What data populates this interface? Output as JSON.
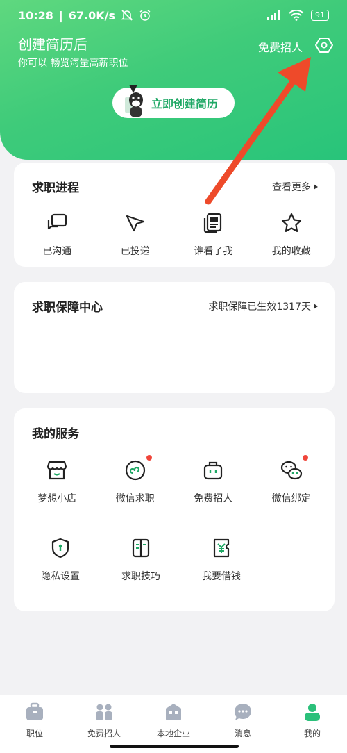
{
  "status_bar": {
    "time": "10:28",
    "speed": "67.0K/s",
    "battery": "91"
  },
  "hero": {
    "title": "创建简历后",
    "subtitle": "你可以 畅览海量高薪职位",
    "free_recruit": "免费招人",
    "create_button": "立即创建简历"
  },
  "job_progress": {
    "title": "求职进程",
    "more": "查看更多",
    "items": [
      {
        "label": "已沟通",
        "icon": "chat-icon"
      },
      {
        "label": "已投递",
        "icon": "send-icon"
      },
      {
        "label": "谁看了我",
        "icon": "document-icon"
      },
      {
        "label": "我的收藏",
        "icon": "star-icon"
      }
    ]
  },
  "guarantee": {
    "title": "求职保障中心",
    "status": "求职保障已生效1317天"
  },
  "services": {
    "title": "我的服务",
    "items": [
      {
        "label": "梦想小店",
        "icon": "shop-icon"
      },
      {
        "label": "微信求职",
        "icon": "mini-program-icon"
      },
      {
        "label": "免费招人",
        "icon": "briefcase-icon"
      },
      {
        "label": "微信绑定",
        "icon": "wechat-icon"
      },
      {
        "label": "隐私设置",
        "icon": "shield-icon"
      },
      {
        "label": "求职技巧",
        "icon": "book-icon"
      },
      {
        "label": "我要借钱",
        "icon": "yuan-icon"
      }
    ]
  },
  "tabbar": {
    "items": [
      {
        "label": "职位",
        "icon": "briefcase-icon"
      },
      {
        "label": "免费招人",
        "icon": "people-icon"
      },
      {
        "label": "本地企业",
        "icon": "building-icon"
      },
      {
        "label": "消息",
        "icon": "message-icon"
      },
      {
        "label": "我的",
        "icon": "person-icon"
      }
    ]
  },
  "colors": {
    "accent": "#28c47a",
    "badge": "#f0453a",
    "annotation_arrow": "#ee4a2a"
  }
}
